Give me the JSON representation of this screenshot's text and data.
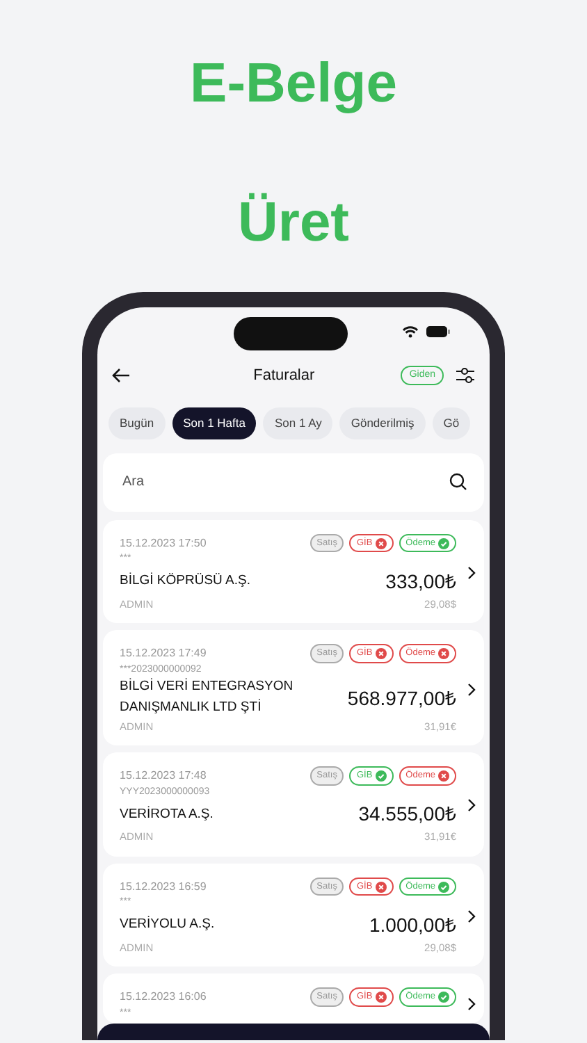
{
  "headline": [
    "E-Belge",
    "Üret"
  ],
  "header": {
    "title": "Faturalar",
    "direction_badge": "Giden"
  },
  "filters": [
    {
      "label": "Bugün",
      "selected": false
    },
    {
      "label": "Son 1 Hafta",
      "selected": true
    },
    {
      "label": "Son 1 Ay",
      "selected": false
    },
    {
      "label": "Gönderilmiş",
      "selected": false
    },
    {
      "label": "Gö",
      "selected": false
    }
  ],
  "search": {
    "placeholder": "Ara"
  },
  "invoices": [
    {
      "datetime": "15.12.2023 17:50",
      "number": "***",
      "customer": "BİLGİ KÖPRÜSÜ A.Ş.",
      "user": "ADMIN",
      "amount": "333,00₺",
      "converted": "29,08$",
      "type": "Satış",
      "gib": {
        "label": "GİB",
        "ok": false
      },
      "payment": {
        "label": "Ödeme",
        "ok": true
      }
    },
    {
      "datetime": "15.12.2023 17:49",
      "number": "***2023000000092",
      "customer": "BİLGİ VERİ ENTEGRASYON DANIŞMANLIK LTD ŞTİ",
      "user": "ADMIN",
      "amount": "568.977,00₺",
      "converted": "31,91€",
      "type": "Satış",
      "gib": {
        "label": "GİB",
        "ok": false
      },
      "payment": {
        "label": "Ödeme",
        "ok": false
      }
    },
    {
      "datetime": "15.12.2023 17:48",
      "number": "YYY2023000000093",
      "customer": "VERİROTA A.Ş.",
      "user": "ADMIN",
      "amount": "34.555,00₺",
      "converted": "31,91€",
      "type": "Satış",
      "gib": {
        "label": "GİB",
        "ok": true
      },
      "payment": {
        "label": "Ödeme",
        "ok": false
      }
    },
    {
      "datetime": "15.12.2023 16:59",
      "number": "***",
      "customer": "VERİYOLU A.Ş.",
      "user": "ADMIN",
      "amount": "1.000,00₺",
      "converted": "29,08$",
      "type": "Satış",
      "gib": {
        "label": "GİB",
        "ok": false
      },
      "payment": {
        "label": "Ödeme",
        "ok": true
      }
    },
    {
      "datetime": "15.12.2023 16:06",
      "number": "***",
      "type": "Satış",
      "gib": {
        "label": "GİB",
        "ok": false
      },
      "payment": {
        "label": "Ödeme",
        "ok": true
      }
    }
  ]
}
